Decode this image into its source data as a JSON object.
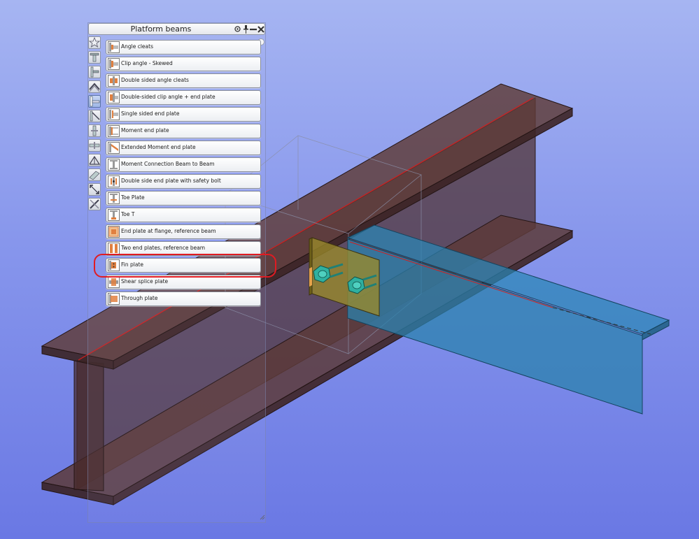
{
  "palette": {
    "title": "Platform beams",
    "title_buttons": [
      {
        "name": "settings-icon"
      },
      {
        "name": "pin-icon"
      },
      {
        "name": "minimize-icon"
      },
      {
        "name": "close-icon"
      }
    ],
    "toolbar": [
      {
        "icon": "star-icon"
      },
      {
        "icon": "beam-column-icon"
      },
      {
        "icon": "column-base-icon"
      },
      {
        "icon": "apex-icon"
      },
      {
        "icon": "platform-beam-icon",
        "active": true
      },
      {
        "icon": "bracing-icon"
      },
      {
        "icon": "column-splice-icon"
      },
      {
        "icon": "beam-splice-icon"
      },
      {
        "icon": "truss-icon"
      },
      {
        "icon": "purlin-icon"
      },
      {
        "icon": "expand-icon"
      },
      {
        "icon": "tools-icon"
      }
    ],
    "items": [
      {
        "label": "Angle cleats",
        "icon": "angle-cleats-icon"
      },
      {
        "label": "Clip angle - Skewed",
        "icon": "clip-angle-skewed-icon"
      },
      {
        "label": "Double sided angle cleats",
        "icon": "double-sided-angle-cleats-icon"
      },
      {
        "label": "Double-sided clip angle + end plate",
        "icon": "double-sided-clip-angle-end-plate-icon"
      },
      {
        "label": "Single sided end plate",
        "icon": "single-sided-end-plate-icon"
      },
      {
        "label": "Moment end plate",
        "icon": "moment-end-plate-icon"
      },
      {
        "label": "Extended Moment end plate",
        "icon": "extended-moment-end-plate-icon"
      },
      {
        "label": "Moment Connection Beam to Beam",
        "icon": "moment-connection-beam-to-beam-icon"
      },
      {
        "label": "Double side end plate with safety bolt",
        "icon": "double-side-end-plate-safety-bolt-icon"
      },
      {
        "label": "Toe Plate",
        "icon": "toe-plate-icon"
      },
      {
        "label": "Toe T",
        "icon": "toe-t-icon"
      },
      {
        "label": "End plate at flange, reference beam",
        "icon": "end-plate-at-flange-icon"
      },
      {
        "label": "Two end plates, reference beam",
        "icon": "two-end-plates-icon"
      },
      {
        "label": "Fin plate",
        "icon": "fin-plate-icon",
        "highlighted": true
      },
      {
        "label": "Shear splice plate",
        "icon": "shear-splice-plate-icon"
      },
      {
        "label": "Through plate",
        "icon": "through-plate-icon"
      }
    ]
  },
  "colors": {
    "main_beam": "#5a3a3a",
    "secondary_beam": "#2f7fa8",
    "fin_plate": "#8a7a2a",
    "bolts": "#2fb0a0",
    "highlight": "#e11b22",
    "axis_line": "#d21e1e"
  }
}
